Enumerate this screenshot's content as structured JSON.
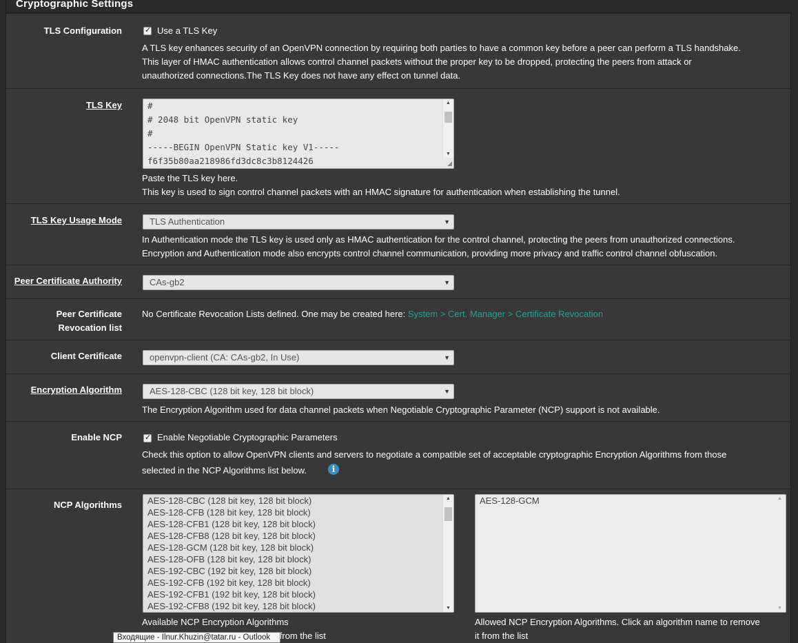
{
  "section": {
    "title": "Cryptographic Settings"
  },
  "tls_config": {
    "label": "TLS Configuration",
    "checkbox_label": "Use a TLS Key",
    "help1": "A TLS key enhances security of an OpenVPN connection by requiring both parties to have a common key before a peer can perform a TLS handshake.",
    "help2": "This layer of HMAC authentication allows control channel packets without the proper key to be dropped, protecting the peers from attack or",
    "help3": "unauthorized connections.The TLS Key does not have any effect on tunnel data."
  },
  "tls_key": {
    "label": "TLS Key",
    "lines": [
      "#",
      "# 2048 bit OpenVPN static key",
      "#",
      "-----BEGIN OpenVPN Static key V1-----",
      "f6f35b80aa218986fd3dc8c3b8124426"
    ],
    "help1": "Paste the TLS key here.",
    "help2": "This key is used to sign control channel packets with an HMAC signature for authentication when establishing the tunnel."
  },
  "tls_mode": {
    "label": "TLS Key Usage Mode",
    "value": "TLS Authentication",
    "help1": "In Authentication mode the TLS key is used only as HMAC authentication for the control channel, protecting the peers from unauthorized connections.",
    "help2": "Encryption and Authentication mode also encrypts control channel communication, providing more privacy and traffic control channel obfuscation."
  },
  "peer_ca": {
    "label": "Peer Certificate Authority",
    "value": "CAs-gb2"
  },
  "peer_crl": {
    "label_line1": "Peer Certificate",
    "label_line2": "Revocation list",
    "text": "No Certificate Revocation Lists defined. One may be created here: ",
    "link": "System > Cert. Manager > Certificate Revocation"
  },
  "client_cert": {
    "label": "Client Certificate",
    "value": "openvpn-client (CA: CAs-gb2, In Use)"
  },
  "enc_algo": {
    "label": "Encryption Algorithm",
    "value": "AES-128-CBC (128 bit key, 128 bit block)",
    "help": "The Encryption Algorithm used for data channel packets when Negotiable Cryptographic Parameter (NCP) support is not available."
  },
  "ncp": {
    "label": "Enable NCP",
    "checkbox_label": "Enable Negotiable Cryptographic Parameters",
    "help1": "Check this option to allow OpenVPN clients and servers to negotiate a compatible set of acceptable cryptographic Encryption Algorithms from those",
    "help2": "selected in the NCP Algorithms list below."
  },
  "ncp_algos": {
    "label": "NCP Algorithms",
    "available": [
      "AES-128-CBC (128 bit key, 128 bit block)",
      "AES-128-CFB (128 bit key, 128 bit block)",
      "AES-128-CFB1 (128 bit key, 128 bit block)",
      "AES-128-CFB8 (128 bit key, 128 bit block)",
      "AES-128-GCM (128 bit key, 128 bit block)",
      "AES-128-OFB (128 bit key, 128 bit block)",
      "AES-192-CBC (192 bit key, 128 bit block)",
      "AES-192-CFB (192 bit key, 128 bit block)",
      "AES-192-CFB1 (192 bit key, 128 bit block)",
      "AES-192-CFB8 (192 bit key, 128 bit block)"
    ],
    "allowed": [
      "AES-128-GCM"
    ],
    "available_help1": "Available NCP Encryption Algorithms",
    "available_help2": "hm from the list",
    "allowed_help1": "Allowed NCP Encryption Algorithms. Click an algorithm name to remove",
    "allowed_help2": "it from the list"
  },
  "tooltip": {
    "text": "Входящие - Ilnur.Khuzin@tatar.ru - Outlook"
  }
}
